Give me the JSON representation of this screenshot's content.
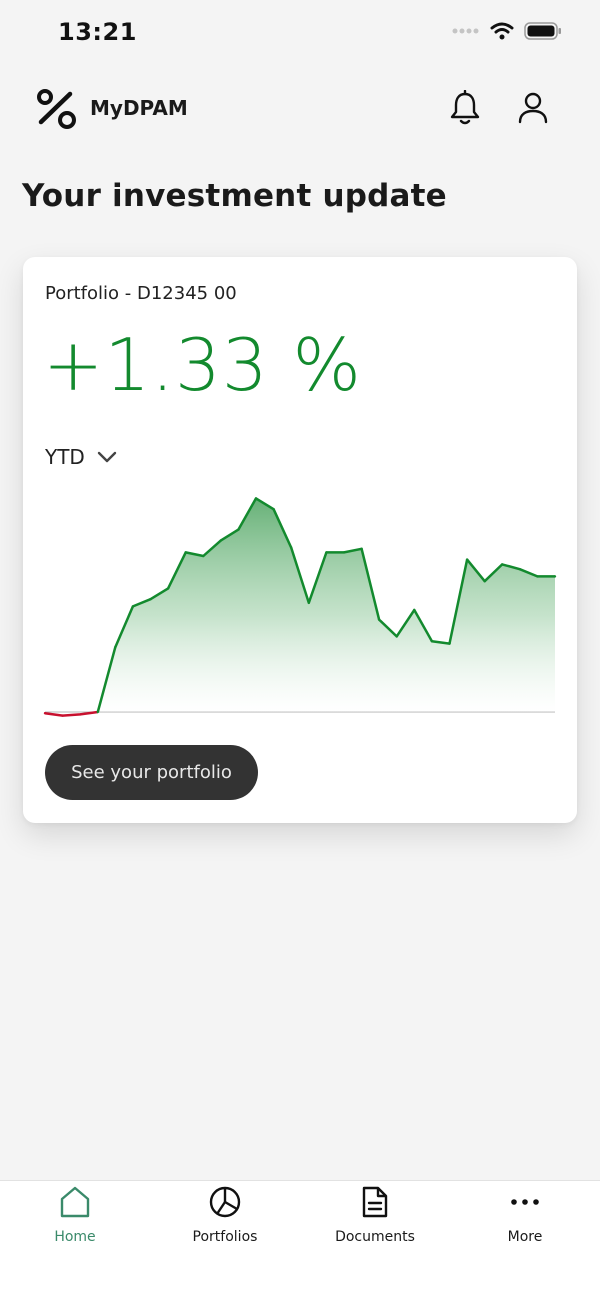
{
  "status_bar": {
    "time": "13:21"
  },
  "header": {
    "app_name": "MyDPAM",
    "logo_icon": "percent-logo-icon",
    "notification_icon": "bell-icon",
    "profile_icon": "user-icon"
  },
  "page": {
    "title": "Your investment update"
  },
  "card": {
    "portfolio_label": "Portfolio - D12345 00",
    "performance": "+1.33 %",
    "period": "YTD",
    "cta_label": "See your portfolio"
  },
  "colors": {
    "accent_green": "#138a2e",
    "negative_red": "#c8102e",
    "button_dark": "#333333",
    "active_tab": "#3a8a6a"
  },
  "chart_data": {
    "type": "area",
    "baseline": 0,
    "x": [
      0,
      1,
      2,
      3,
      4,
      5,
      6,
      7,
      8,
      9,
      10,
      11,
      12,
      13,
      14,
      15,
      16,
      17,
      18,
      19,
      20,
      21,
      22,
      23,
      24,
      25,
      26,
      27,
      28,
      29
    ],
    "values": [
      -0.1,
      -0.3,
      -0.2,
      0.0,
      5.4,
      8.8,
      9.4,
      10.3,
      13.3,
      13.0,
      14.3,
      15.2,
      17.8,
      16.9,
      13.7,
      9.1,
      13.3,
      13.3,
      13.6,
      7.7,
      6.3,
      8.5,
      5.9,
      5.7,
      12.7,
      10.9,
      12.3,
      11.9,
      11.3,
      11.3
    ],
    "title": "",
    "xlabel": "",
    "ylabel": "",
    "grid": false
  },
  "tabs": [
    {
      "label": "Home",
      "icon": "home-icon",
      "active": true
    },
    {
      "label": "Portfolios",
      "icon": "pie-chart-icon",
      "active": false
    },
    {
      "label": "Documents",
      "icon": "document-icon",
      "active": false
    },
    {
      "label": "More",
      "icon": "more-dots-icon",
      "active": false
    }
  ]
}
